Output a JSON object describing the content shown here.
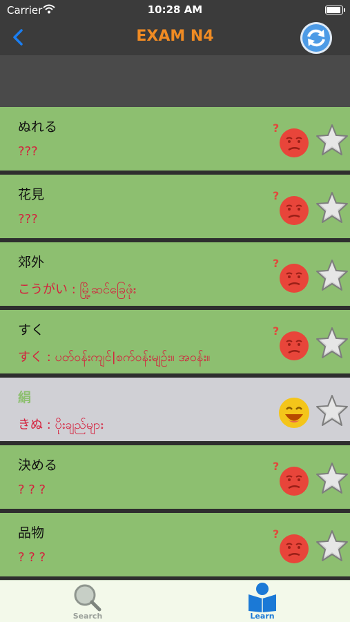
{
  "status_bar": {
    "carrier": "Carrier",
    "time": "10:28 AM"
  },
  "nav": {
    "title": "EXAM N4"
  },
  "rows": [
    {
      "word": "ぬれる",
      "meaning": "???",
      "status": "confused"
    },
    {
      "word": "花見",
      "meaning": "???",
      "status": "confused"
    },
    {
      "word": "郊外",
      "meaning": "こうがい : မြို့ဆင်ခြေဖုံး",
      "status": "confused"
    },
    {
      "word": "すく",
      "meaning": "すく : ပတ်ဝန်းကျင်|စက်ဝန်းမျဉ်း။ အဝန်း။",
      "status": "confused"
    },
    {
      "word": "絹",
      "meaning": "きぬ : ပိုးချည်များ",
      "status": "learned"
    },
    {
      "word": "決める",
      "meaning": "? ? ?",
      "status": "confused"
    },
    {
      "word": "品物",
      "meaning": "? ? ?",
      "status": "confused"
    }
  ],
  "tabbar": {
    "search_label": "Search",
    "learn_label": "Learn",
    "active": "learn"
  },
  "colors": {
    "title": "#f08b23",
    "row_green": "#8dbf70",
    "row_learned": "#d0d0d5",
    "meaning_red": "#d4213d",
    "accent_blue": "#1b79d6"
  }
}
